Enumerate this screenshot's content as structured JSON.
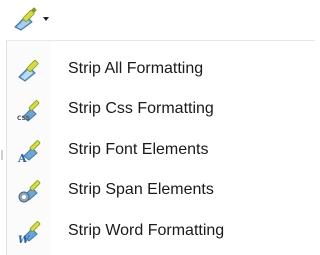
{
  "toolbar": {
    "icon": "broom-format-icon"
  },
  "menu": {
    "items": [
      {
        "label": "Strip All Formatting",
        "icon": "strip-all-formatting-icon",
        "badge": ""
      },
      {
        "label": "Strip Css Formatting",
        "icon": "strip-css-formatting-icon",
        "badge": "CSS"
      },
      {
        "label": "Strip Font Elements",
        "icon": "strip-font-elements-icon",
        "badge": "A"
      },
      {
        "label": "Strip Span Elements",
        "icon": "strip-span-elements-icon",
        "badge": ""
      },
      {
        "label": "Strip Word Formatting",
        "icon": "strip-word-formatting-icon",
        "badge": "W"
      }
    ]
  },
  "colors": {
    "broom_handle": "#c8d23a",
    "broom_head": "#6aa6d8",
    "text": "#1a1a1a"
  }
}
